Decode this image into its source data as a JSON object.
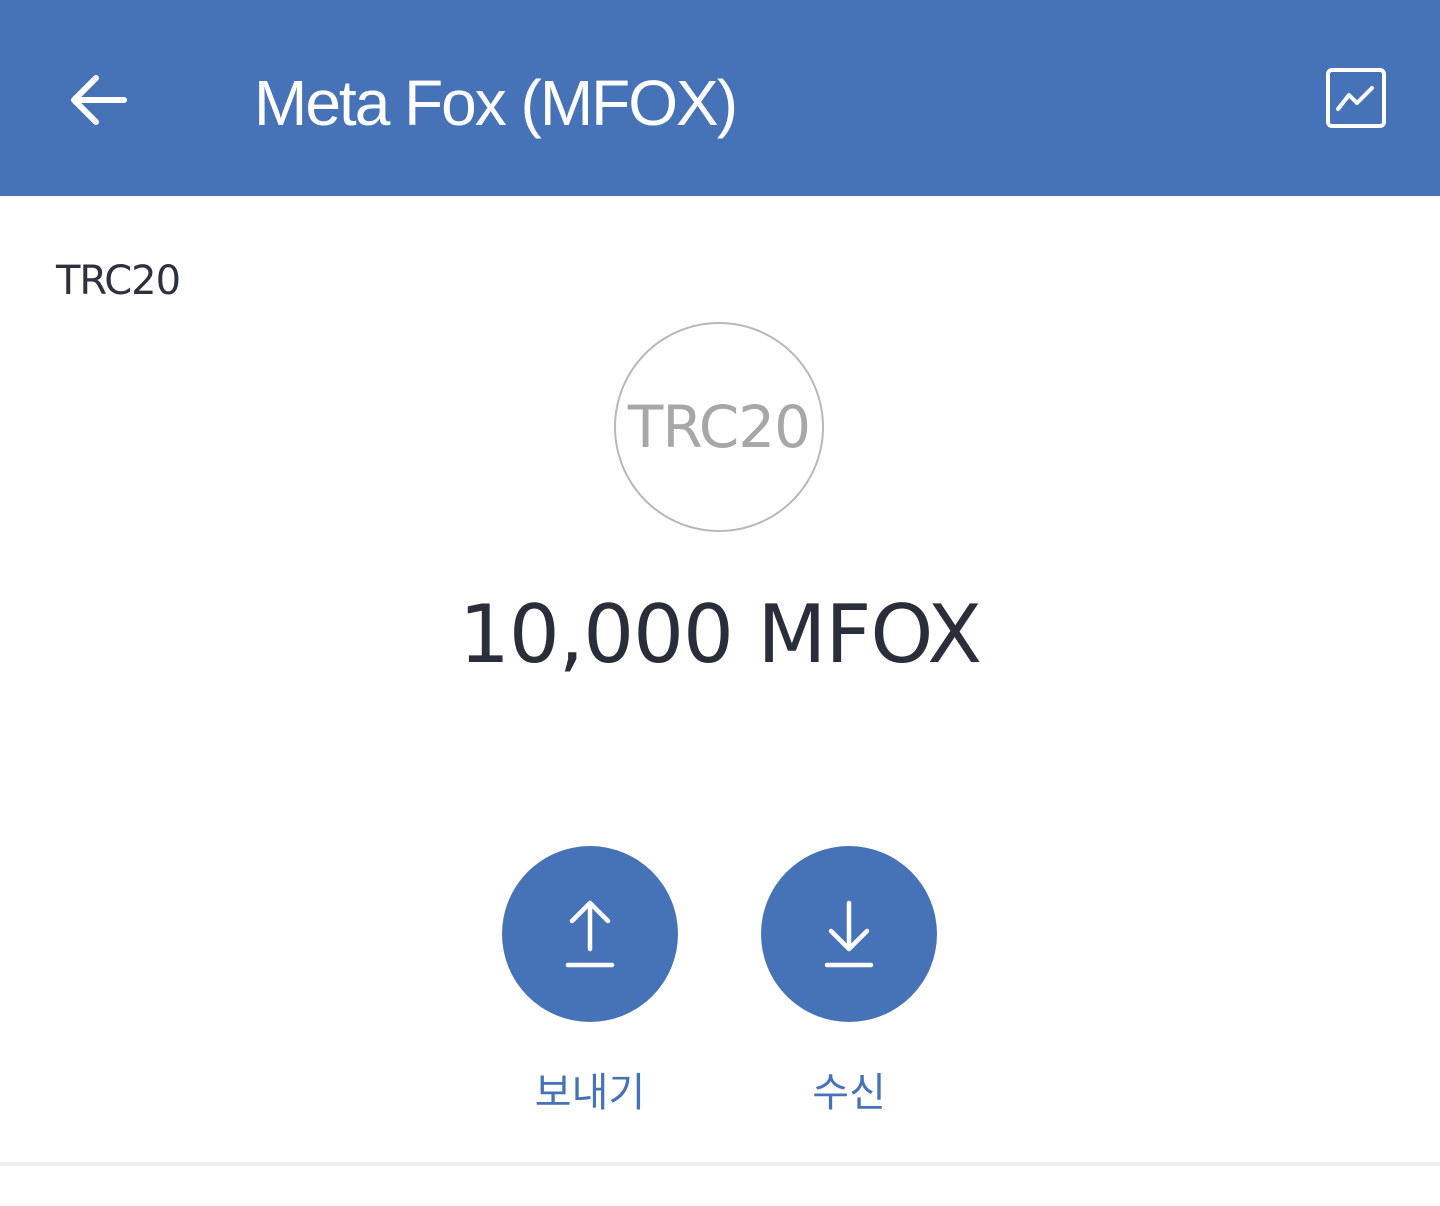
{
  "header": {
    "title": "Meta Fox (MFOX)",
    "back_icon": "arrow-left-icon",
    "chart_icon": "chart-icon"
  },
  "token": {
    "network": "TRC20",
    "logo_text": "TRC20",
    "balance": "10,000 MFOX"
  },
  "actions": {
    "send_label": "보내기",
    "send_icon": "upload-icon",
    "receive_label": "수신",
    "receive_icon": "download-icon"
  },
  "colors": {
    "primary": "#4673b7",
    "text_dark": "#2a2e3b",
    "logo_gray": "#a7a7a7",
    "background": "#ffffff"
  }
}
